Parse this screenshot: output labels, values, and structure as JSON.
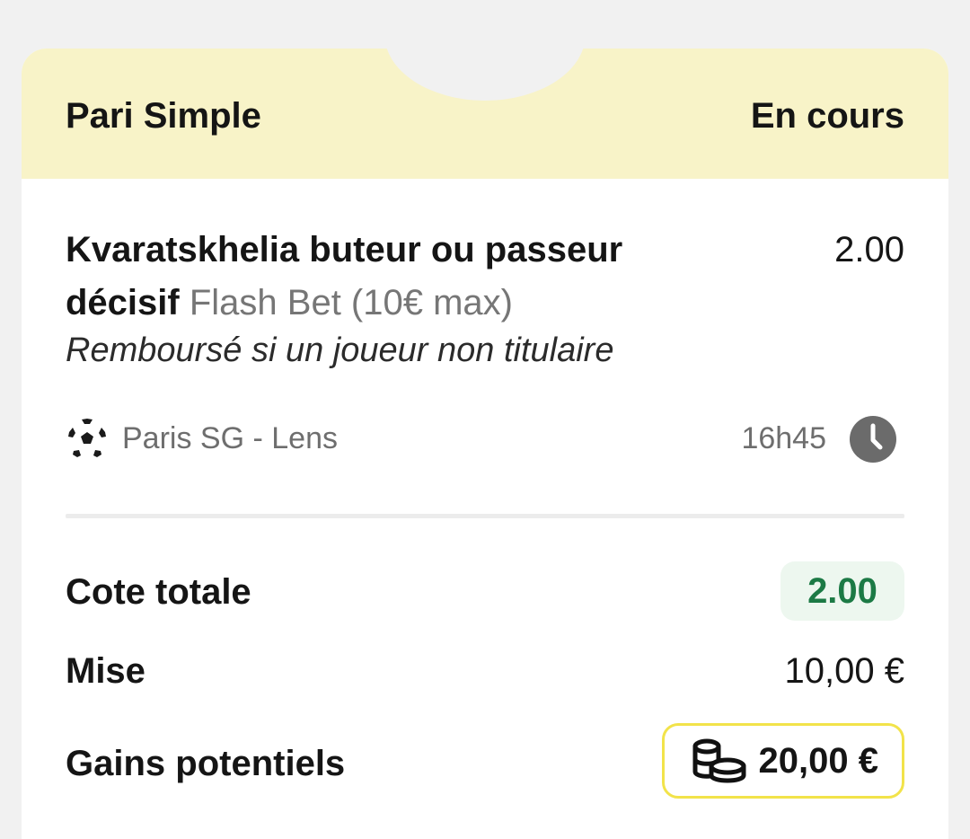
{
  "bet": {
    "type_label": "Pari Simple",
    "status": "En cours"
  },
  "selection": {
    "name": "Kvaratskhelia buteur ou passeur décisif",
    "promo": "Flash Bet (10€ max)",
    "odd": "2.00",
    "condition": "Remboursé si un joueur non titulaire"
  },
  "event": {
    "sport_icon": "soccer-ball-icon",
    "name": "Paris SG - Lens",
    "time": "16h45",
    "time_icon": "clock-icon"
  },
  "summary": {
    "total_odds_label": "Cote totale",
    "total_odds_value": "2.00",
    "stake_label": "Mise",
    "stake_value": "10,00 €",
    "potential_gains_label": "Gains potentiels",
    "potential_gains_value": "20,00 €",
    "gains_icon": "coins-icon"
  },
  "colors": {
    "header_bg": "#f8f3c8",
    "odds_badge_bg": "#edf7ef",
    "odds_badge_text": "#1c7a45",
    "gains_border": "#f2e34a",
    "page_bg": "#f1f1f1"
  }
}
